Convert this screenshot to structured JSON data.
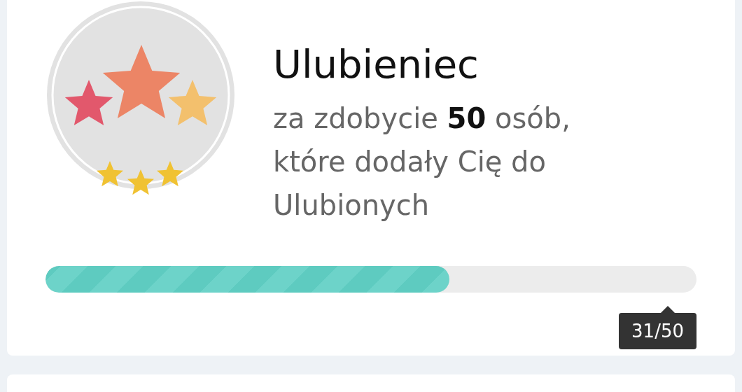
{
  "achievement": {
    "title": "Ulubieniec",
    "description": "za zdobycie **50** osób, które dodały Cię do Ulubionych",
    "progress": {
      "level": 0.62,
      "reading": "31/50"
    }
  }
}
